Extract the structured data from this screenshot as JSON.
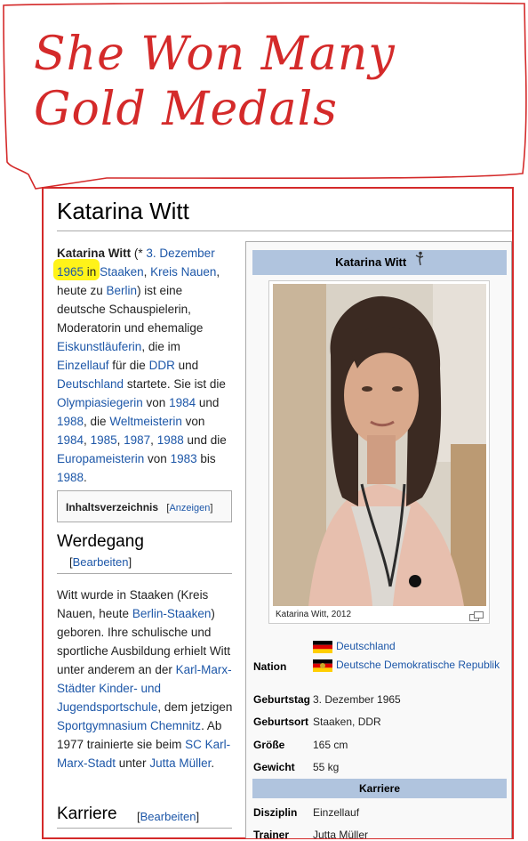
{
  "note": {
    "handwriting": "She Won Many Gold Medals",
    "ink_color": "#d42a2a"
  },
  "article": {
    "title": "Katarina Witt",
    "lead": {
      "name": "Katarina Witt",
      "p1": " (* ",
      "birth_date_link": "3. Dezember",
      "birth_year": "1965",
      "in_word": " in ",
      "place1_link": "Staaken",
      "comma": ", ",
      "place2_link": "Kreis Nauen",
      "p2": ", heute zu ",
      "berlin_link": "Berlin",
      "p3": ") ist eine deutsche Schauspielerin, Moderatorin und ehemalige ",
      "skater_link": "Eiskunstläuferin",
      "p4": ", die im ",
      "single_link": "Einzellauf",
      "p5": " für die ",
      "ddr_link": "DDR",
      "p6": " und ",
      "germany_link": "Deutschland",
      "p7": " startete. Sie ist die ",
      "olympic_link": "Olympiasiegerin",
      "p8": " von ",
      "y1984a": "1984",
      "p9": " und ",
      "y1988a": "1988",
      "p10": ", die ",
      "world_link": "Weltmeisterin",
      "p11": " von ",
      "y1984b": "1984",
      "sep1": ", ",
      "y1985": "1985",
      "sep2": ", ",
      "y1987": "1987",
      "sep3": ", ",
      "y1988b": "1988",
      "p12": " und die ",
      "euro_link": "Europameisterin",
      "p13": " von ",
      "y1983": "1983",
      "p14": " bis ",
      "y1988c": "1988",
      "p15": "."
    },
    "toc": {
      "title": "Inhaltsverzeichnis",
      "toggle_open": "[",
      "toggle": "Anzeigen",
      "toggle_close": "]"
    },
    "sections": {
      "werdegang": {
        "heading": "Werdegang",
        "edit_open": "[",
        "edit": "Bearbeiten",
        "edit_close": "]",
        "t1": "Witt wurde in Staaken (Kreis Nauen, heute ",
        "l1": "Berlin-Staaken",
        "t2": ") geboren. Ihre schulische und sportliche Ausbildung erhielt Witt unter anderem an der ",
        "l2": "Karl-Marx-Städter Kinder- und Jugendsportschule",
        "t3": ", dem jetzigen ",
        "l3": "Sportgymnasium Chemnitz",
        "t4": ". Ab 1977 trainierte sie beim ",
        "l4": "SC Karl-Marx-Stadt",
        "t5": " unter ",
        "l5": "Jutta Müller",
        "t6": "."
      },
      "karriere": {
        "heading": "Karriere",
        "edit_open": "[",
        "edit": "Bearbeiten",
        "edit_close": "]"
      }
    }
  },
  "infobox": {
    "title": "Katarina Witt",
    "title_icon": "figure-skater-icon",
    "caption": "Katarina Witt, 2012",
    "nation_label": "Nation",
    "nations": [
      "Deutschland",
      "Deutsche Demokratische Republik"
    ],
    "birthdate_label": "Geburtstag",
    "birthdate": "3. Dezember 1965",
    "birthplace_label": "Geburtsort",
    "birthplace": "Staaken, DDR",
    "height_label": "Größe",
    "height": "165 cm",
    "weight_label": "Gewicht",
    "weight": "55 kg",
    "career_header": "Karriere",
    "discipline_label": "Disziplin",
    "discipline": "Einzellauf",
    "trainer_label": "Trainer",
    "trainer": "Jutta Müller"
  },
  "colors": {
    "link": "#1d57a8",
    "infobox_header": "#b0c4de",
    "highlight": "#fff200",
    "annotation": "#d42a2a"
  }
}
